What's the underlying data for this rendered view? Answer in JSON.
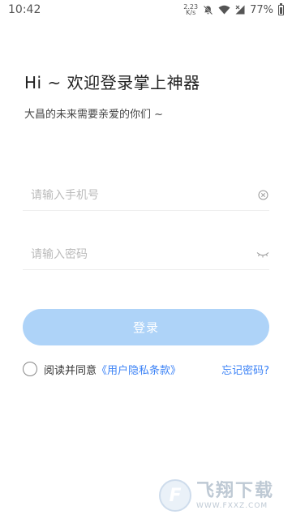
{
  "status_bar": {
    "time": "10:42",
    "net_speed_value": "2.23",
    "net_speed_unit": "K/s",
    "battery_percent": "77%"
  },
  "header": {
    "title": "Hi ~ 欢迎登录掌上神器",
    "subtitle": "大昌的未来需要亲爱的你们 ~"
  },
  "form": {
    "phone_placeholder": "请输入手机号",
    "phone_value": "",
    "password_placeholder": "请输入密码",
    "password_value": "",
    "login_label": "登录"
  },
  "agreement": {
    "text": "阅读并同意",
    "link": "《用户隐私条款》",
    "forgot": "忘记密码?"
  },
  "watermark": {
    "main": "飞翔下载",
    "sub": "WWW.FXXZ.COM"
  },
  "colors": {
    "accent": "#3b82f6",
    "button_bg": "#aed3f8"
  },
  "icons": {
    "clear": "clear-circle-icon",
    "eye": "eye-closed-icon"
  }
}
